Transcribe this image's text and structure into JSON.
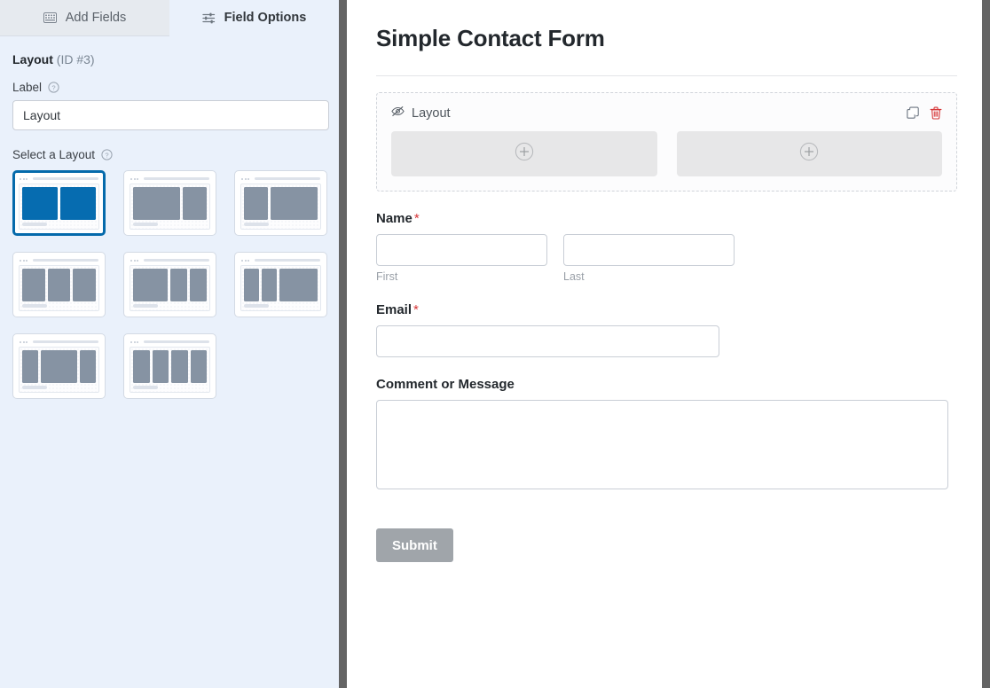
{
  "tabs": [
    {
      "label": "Add Fields",
      "icon": "form-icon",
      "active": false
    },
    {
      "label": "Field Options",
      "icon": "sliders-icon",
      "active": true
    }
  ],
  "sidebar": {
    "field_name": "Layout",
    "field_id": "(ID #3)",
    "label_section": {
      "label": "Label",
      "help_icon": "help-circle-icon",
      "value": "Layout",
      "placeholder": ""
    },
    "layout_section": {
      "label": "Select a Layout",
      "help_icon": "help-circle-icon",
      "selected_index": 0,
      "options": [
        {
          "name": "two-column-equal",
          "columns": [
            50,
            50
          ],
          "selected": true
        },
        {
          "name": "two-column-wide-narrow",
          "columns": [
            66,
            34
          ],
          "selected": false
        },
        {
          "name": "two-column-narrow-wide",
          "columns": [
            34,
            66
          ],
          "selected": false
        },
        {
          "name": "three-column-equal",
          "columns": [
            33,
            33,
            33
          ],
          "selected": false
        },
        {
          "name": "three-column-wide-narrow-narrow",
          "columns": [
            50,
            25,
            25
          ],
          "selected": false
        },
        {
          "name": "three-column-narrow-narrow-wide",
          "columns": [
            22,
            22,
            56
          ],
          "selected": false
        },
        {
          "name": "three-column-narrow-wide-narrow",
          "columns": [
            24,
            52,
            24
          ],
          "selected": false
        },
        {
          "name": "four-column-equal",
          "columns": [
            25,
            25,
            25,
            25
          ],
          "selected": false
        }
      ]
    }
  },
  "preview": {
    "form_title": "Simple Contact Form",
    "layout_field": {
      "label": "Layout",
      "hidden_icon": "eye-slash-icon",
      "duplicate_icon": "duplicate-icon",
      "delete_icon": "trash-icon",
      "columns": [
        {
          "add_icon": "circle-plus-icon"
        },
        {
          "add_icon": "circle-plus-icon"
        }
      ]
    },
    "fields": [
      {
        "name": "name",
        "label": "Name",
        "required": true,
        "required_mark": "*",
        "sublabels": [
          "First",
          "Last"
        ]
      },
      {
        "name": "email",
        "label": "Email",
        "required": true,
        "required_mark": "*"
      },
      {
        "name": "comment",
        "label": "Comment or Message",
        "required": false,
        "required_mark": ""
      }
    ],
    "submit_label": "Submit"
  },
  "colors": {
    "accent": "#056aab",
    "sidebar_bg": "#eaf1fb",
    "required": "#d63638",
    "delete": "#d63638",
    "submit_bg": "#a0a5aa",
    "thumb_column": "#8693a3",
    "thumb_column_selected": "#066cb0"
  }
}
